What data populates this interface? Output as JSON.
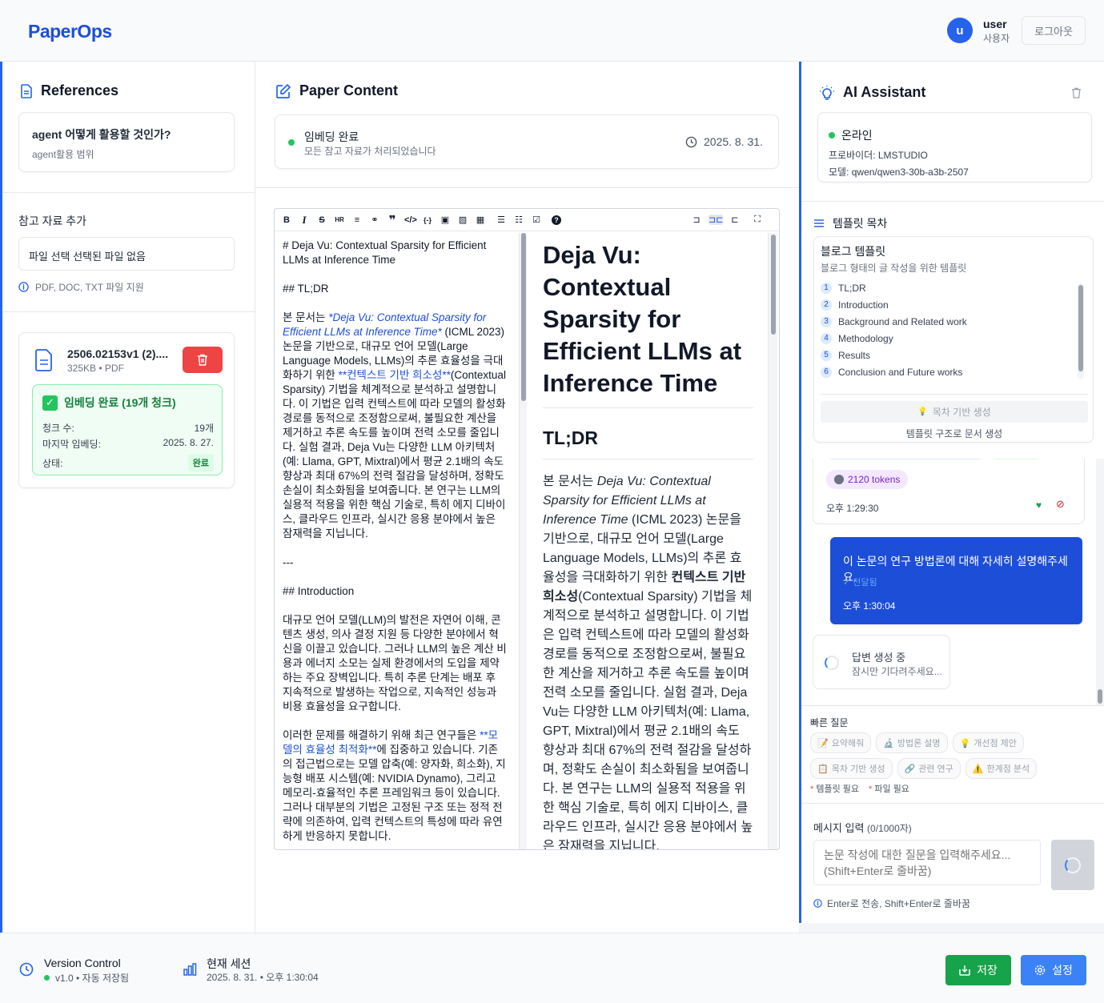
{
  "header": {
    "logo": "PaperOps",
    "avatar_letter": "u",
    "user_name": "user",
    "user_role": "사용자",
    "logout_label": "로그아웃"
  },
  "left": {
    "title": "References",
    "ref_question": "agent 어떻게 활용할 것인가?",
    "ref_sub": "agent활용 범위",
    "add_title": "참고 자료 추가",
    "file_input": "파일 선택 선택된 파일 없음",
    "file_hint": "PDF, DOC, TXT 파일 지원",
    "file": {
      "name": "2506.02153v1 (2)....",
      "meta": "325KB • PDF",
      "embed_title": "임베딩 완료 (19개 청크)",
      "chunk_label": "청크 수:",
      "chunk_value": "19개",
      "last_label": "마지막 임베딩:",
      "last_value": "2025. 8. 27.",
      "state_label": "상태:",
      "state_value": "완료"
    }
  },
  "middle": {
    "title": "Paper Content",
    "status_title": "임베딩 완료",
    "status_sub": "모든 참고 자료가 처리되었습니다",
    "status_date": "2025. 8. 31.",
    "md": {
      "h1": "# Deja Vu: Contextual Sparsity for Efficient LLMs at Inference Time",
      "h2": "## TL;DR",
      "p1_pre": "본 문서는 ",
      "p1_link": "*Deja Vu: Contextual Sparsity for Efficient LLMs at Inference Time*",
      "p1_mid": " (ICML 2023) 논문을 기반으로, 대규모 언어 모델(Large Language Models, LLMs)의 추론 효율성을 극대화하기 위한 ",
      "p1_bold": "**컨텍스트 기반 희소성**",
      "p1_post": "(Contextual Sparsity) 기법을 체계적으로 분석하고 설명합니다. 이 기법은 입력 컨텍스트에 따라 모델의 활성화 경로를 동적으로 조정함으로써, 불필요한 계산을 제거하고 추론 속도를 높이며 전력 소모를 줄입니다. 실험 결과, Deja Vu는 다양한 LLM 아키텍처(예: Llama, GPT, Mixtral)에서 평균 2.1배의 속도 향상과 최대 67%의 전력 절감을 달성하며, 정확도 손실이 최소화됨을 보여줍니다. 본 연구는 LLM의 실용적 적용을 위한 핵심 기술로, 특히 에지 디바이스, 클라우드 인프라, 실시간 응용 분야에서 높은 잠재력을 지닙니다.",
      "hr": "---",
      "h2b": "## Introduction",
      "p2": "대규모 언어 모델(LLM)의 발전은 자연어 이해, 콘텐츠 생성, 의사 결정 지원 등 다양한 분야에서 혁신을 이끌고 있습니다. 그러나 LLM의 높은 계산 비용과 에너지 소모는 실제 환경에서의 도입을 제약하는 주요 장벽입니다. 특히 추론 단계는 배포 후 지속적으로 발생하는 작업으로, 지속적인 성능과 비용 효율성을 요구합니다.",
      "p3_pre": "이러한 문제를 해결하기 위해 최근 연구들은 ",
      "p3_bold": "**모델의 효율성 최적화**",
      "p3_post": "에 집중하고 있습니다. 기존의 접근법으로는 모델 압축(예: 양자화, 희소화), 지능형 배포 시스템(예: NVIDIA Dynamo), 그리고 메모리-효율적인 추론 프레임워크 등이 있습니다. 그러나 대부분의 기법은 고정된 구조 또는 정적 전략에 의존하여, 입력 컨텍스트의 특성에 따라 유연하게 반응하지 못합니다."
    },
    "preview": {
      "h1": "Deja Vu: Contextual Sparsity for Efficient LLMs at Inference Time",
      "h2": "TL;DR",
      "p_pre": "본 문서는 ",
      "p_em": "Deja Vu: Contextual Sparsity for Efficient LLMs at Inference Time",
      "p_mid": " (ICML 2023) 논문을 기반으로, 대규모 언어 모델(Large Language Models, LLMs)의 추론 효율성을 극대화하기 위한 ",
      "p_bold": "컨텍스트 기반 희소성",
      "p_post": "(Contextual Sparsity) 기법을 체계적으로 분석하고 설명합니다. 이 기법은 입력 컨텍스트에 따라 모델의 활성화 경로를 동적으로 조정함으로써, 불필요한 계산을 제거하고 추론 속도를 높이며 전력 소모를 줄입니다. 실험 결과, Deja Vu는 다양한 LLM 아키텍처(예: Llama, GPT, Mixtral)에서 평균 2.1배의 속도 향상과 최대 67%의 전력 절감을 달성하며, 정확도 손실이 최소화됨을 보여줍니다. 본 연구는 LLM의 실용적 적용을 위한 핵심 기술로, 특히 에지 디바이스, 클라우드 인프라, 실시간 응용 분야에서 높은 잠재력을 지닙니다."
    }
  },
  "right": {
    "title": "AI Assistant",
    "status": "온라인",
    "provider": "프로바이더: LMSTUDIO",
    "model": "모델: qwen/qwen3-30b-a3b-2507",
    "toc_title": "템플릿 목차",
    "template_name": "블로그 템플릿",
    "template_desc": "블로그 형태의 글 작성을 위한 템플릿",
    "toc_items": [
      {
        "num": "1",
        "label": "TL;DR"
      },
      {
        "num": "2",
        "label": "Introduction"
      },
      {
        "num": "3",
        "label": "Background and Related work"
      },
      {
        "num": "4",
        "label": "Methodology"
      },
      {
        "num": "5",
        "label": "Results"
      },
      {
        "num": "6",
        "label": "Conclusion and Future works"
      }
    ],
    "toc_button": "목차 기반 생성",
    "toc_caption": "템플릿 구조로 문서 생성",
    "tokens": "2120 tokens",
    "msg_time_1": "오후 1:29:30",
    "user_msg": "이 논문의 연구 방법론에 대해 자세히 설명해주세요.",
    "user_delivered": "✓ 전달됨",
    "user_time": "오후 1:30:04",
    "gen_title": "답변 생성 중",
    "gen_sub": "잠시만 기다려주세요...",
    "quick_title": "빠른 질문",
    "quick_chips": [
      {
        "icon": "📝",
        "label": "요약해줘"
      },
      {
        "icon": "🔬",
        "label": "방법론 설명"
      },
      {
        "icon": "💡",
        "label": "개선점 제안"
      },
      {
        "icon": "📋",
        "label": "목차 기반 생성"
      },
      {
        "icon": "🔗",
        "label": "관련 연구"
      },
      {
        "icon": "⚠️",
        "label": "한계점 분석"
      }
    ],
    "req_template": "템플릿 필요",
    "req_file": "파일 필요",
    "input_label": "메시지 입력",
    "input_count": "(0/1000자)",
    "input_placeholder": "논문 작성에 대한 질문을 입력해주세요... (Shift+Enter로 줄바꿈)",
    "input_hint": "Enter로 전송, Shift+Enter로 줄바꿈"
  },
  "footer": {
    "vc_title": "Version Control",
    "vc_sub": "v1.0 • 자동 저장됨",
    "session_title": "현재 세션",
    "session_sub": "2025. 8. 31. • 오후 1:30:04",
    "save_label": "저장",
    "settings_label": "설정"
  },
  "colors": {
    "brand": "#1d4ed8",
    "accent": "#2563eb",
    "success": "#16a34a",
    "danger": "#ef4444"
  }
}
